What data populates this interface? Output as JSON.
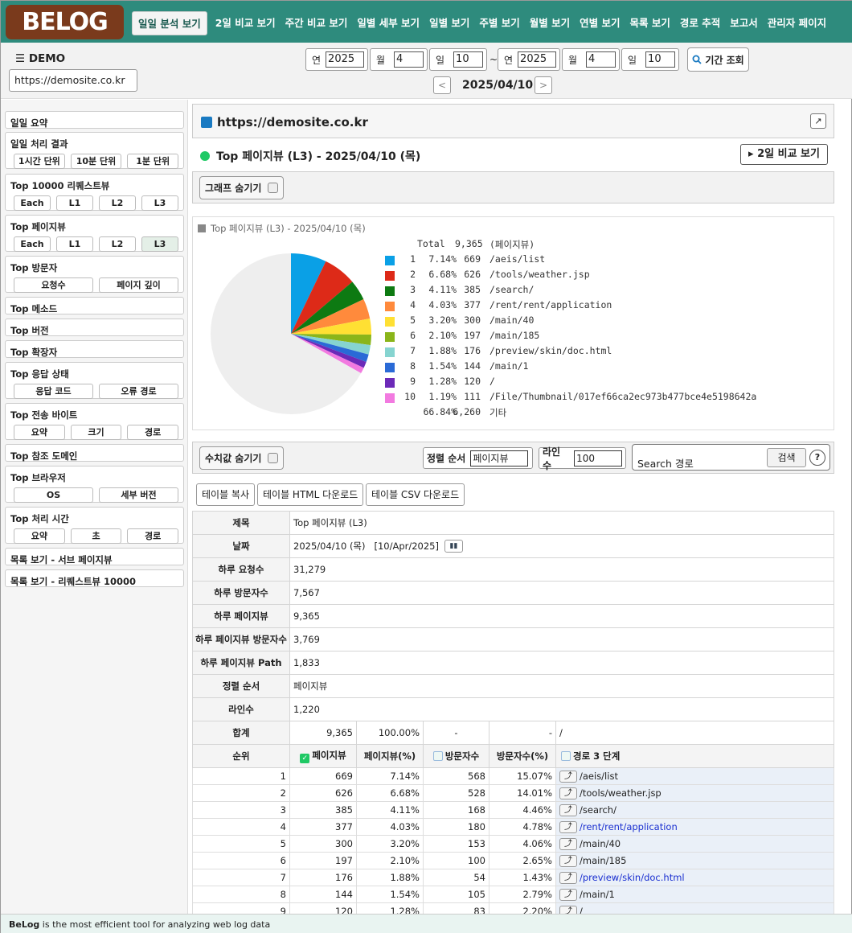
{
  "logo": "BELOG",
  "nav": [
    "일일 분석 보기",
    "2일 비교 보기",
    "주간 비교 보기",
    "일별 세부 보기",
    "일별 보기",
    "주별 보기",
    "월별 보기",
    "연별 보기",
    "목록 보기",
    "경로 추적",
    "보고서",
    "관리자 페이지"
  ],
  "header": {
    "demo": "DEMO",
    "site": "https://demosite.co.kr",
    "from": {
      "y_label": "연",
      "y": "2025",
      "m_label": "월",
      "m": "4",
      "d_label": "일",
      "d": "10"
    },
    "to": {
      "y_label": "연",
      "y": "2025",
      "m_label": "월",
      "m": "4",
      "d_label": "일",
      "d": "10"
    },
    "tilde": "~",
    "query": "기간 조회",
    "date": "2025/04/10"
  },
  "sidebar": [
    {
      "title": "일일 요약",
      "buttons": []
    },
    {
      "title": "일일 처리 결과",
      "buttons": [
        "1시간 단위",
        "10분 단위",
        "1분 단위"
      ]
    },
    {
      "title": "Top 10000 리퀘스트뷰",
      "buttons": [
        "Each",
        "L1",
        "L2",
        "L3"
      ]
    },
    {
      "title": "Top 페이지뷰",
      "buttons": [
        "Each",
        "L1",
        "L2",
        "L3"
      ]
    },
    {
      "title": "Top 방문자",
      "buttons": [
        "요청수",
        "페이지 깊이"
      ]
    },
    {
      "title": "Top 메소드",
      "buttons": []
    },
    {
      "title": "Top 버전",
      "buttons": []
    },
    {
      "title": "Top 확장자",
      "buttons": []
    },
    {
      "title": "Top 응답 상태",
      "buttons": [
        "응답 코드",
        "오류 경로"
      ]
    },
    {
      "title": "Top 전송 바이트",
      "buttons": [
        "요약",
        "크기",
        "경로"
      ]
    },
    {
      "title": "Top 참조 도메인",
      "buttons": []
    },
    {
      "title": "Top 브라우저",
      "buttons": [
        "OS",
        "세부 버전"
      ]
    },
    {
      "title": "Top 처리 시간",
      "buttons": [
        "요약",
        "초",
        "경로"
      ]
    },
    {
      "title": "목록 보기 - 서브 페이지뷰",
      "buttons": []
    },
    {
      "title": "목록 보기 - 리퀘스트뷰 10000",
      "buttons": []
    }
  ],
  "main": {
    "site": "https://demosite.co.kr",
    "section": "Top 페이지뷰 (L3) - 2025/04/10 (목)",
    "compare": "2일 비교 보기",
    "hide_graph": "그래프 숨기기",
    "hide_values": "수치값 숨기기",
    "sort_label": "정렬 순서",
    "sort_value": "페이지뷰",
    "lines_label": "라인수",
    "lines_value": "100",
    "search_placeholder": "Search 경로",
    "search_btn": "검색",
    "help": "?",
    "copy": "테이블 복사",
    "html": "테이블 HTML 다운로드",
    "csv": "테이블 CSV 다운로드"
  },
  "chart_data": {
    "type": "pie",
    "title": "Top 페이지뷰 (L3) - 2025/04/10 (목)",
    "total_label": "Total",
    "total": "9,365",
    "total_unit": "(페이지뷰)",
    "slices": [
      {
        "rank": "1",
        "pct": "7.14%",
        "count": "669",
        "path": "/aeis/list",
        "color": "#0aa0e6",
        "value": 7.14
      },
      {
        "rank": "2",
        "pct": "6.68%",
        "count": "626",
        "path": "/tools/weather.jsp",
        "color": "#dd2a18",
        "value": 6.68
      },
      {
        "rank": "3",
        "pct": "4.11%",
        "count": "385",
        "path": "/search/",
        "color": "#0d7a12",
        "value": 4.11
      },
      {
        "rank": "4",
        "pct": "4.03%",
        "count": "377",
        "path": "/rent/rent/application",
        "color": "#ff8a3c",
        "value": 4.03
      },
      {
        "rank": "5",
        "pct": "3.20%",
        "count": "300",
        "path": "/main/40",
        "color": "#ffe033",
        "value": 3.2
      },
      {
        "rank": "6",
        "pct": "2.10%",
        "count": "197",
        "path": "/main/185",
        "color": "#8ab51a",
        "value": 2.1
      },
      {
        "rank": "7",
        "pct": "1.88%",
        "count": "176",
        "path": "/preview/skin/doc.html",
        "color": "#86d4d0",
        "value": 1.88
      },
      {
        "rank": "8",
        "pct": "1.54%",
        "count": "144",
        "path": "/main/1",
        "color": "#2a6ad6",
        "value": 1.54
      },
      {
        "rank": "9",
        "pct": "1.28%",
        "count": "120",
        "path": "/",
        "color": "#6c2ab8",
        "value": 1.28
      },
      {
        "rank": "10",
        "pct": "1.19%",
        "count": "111",
        "path": "/File/Thumbnail/017ef66ca2ec973b477bce4e5198642a",
        "color": "#f27ae0",
        "value": 1.19
      }
    ],
    "other": {
      "pct": "66.84%",
      "count": "6,260",
      "label": "기타",
      "color": "#eeeeee",
      "value": 66.84
    }
  },
  "info": [
    {
      "k": "제목",
      "v": "Top 페이지뷰 (L3)"
    },
    {
      "k": "날짜",
      "v": "2025/04/10 (목)   [10/Apr/2025]"
    },
    {
      "k": "하루 요청수",
      "v": "31,279"
    },
    {
      "k": "하루 방문자수",
      "v": "7,567"
    },
    {
      "k": "하루 페이지뷰",
      "v": "9,365"
    },
    {
      "k": "하루 페이지뷰 방문자수",
      "v": "3,769"
    },
    {
      "k": "하루 페이지뷰 Path",
      "v": "1,833"
    },
    {
      "k": "정렬 순서",
      "v": "페이지뷰"
    },
    {
      "k": "라인수",
      "v": "1,220"
    }
  ],
  "sum": {
    "k": "합계",
    "pv": "9,365",
    "pvp": "100.00%",
    "vis": "-",
    "visp": "-",
    "path": "/"
  },
  "cols": {
    "rank": "순위",
    "pv": "페이지뷰",
    "pvp": "페이지뷰(%)",
    "vis": "방문자수",
    "visp": "방문자수(%)",
    "path": "경로 3 단계"
  },
  "rows": [
    {
      "r": "1",
      "pv": "669",
      "pvp": "7.14%",
      "v": "568",
      "vp": "15.07%",
      "p": "/aeis/list",
      "link": false
    },
    {
      "r": "2",
      "pv": "626",
      "pvp": "6.68%",
      "v": "528",
      "vp": "14.01%",
      "p": "/tools/weather.jsp",
      "link": false
    },
    {
      "r": "3",
      "pv": "385",
      "pvp": "4.11%",
      "v": "168",
      "vp": "4.46%",
      "p": "/search/",
      "link": false
    },
    {
      "r": "4",
      "pv": "377",
      "pvp": "4.03%",
      "v": "180",
      "vp": "4.78%",
      "p": "/rent/rent/application",
      "link": true
    },
    {
      "r": "5",
      "pv": "300",
      "pvp": "3.20%",
      "v": "153",
      "vp": "4.06%",
      "p": "/main/40",
      "link": false
    },
    {
      "r": "6",
      "pv": "197",
      "pvp": "2.10%",
      "v": "100",
      "vp": "2.65%",
      "p": "/main/185",
      "link": false
    },
    {
      "r": "7",
      "pv": "176",
      "pvp": "1.88%",
      "v": "54",
      "vp": "1.43%",
      "p": "/preview/skin/doc.html",
      "link": true
    },
    {
      "r": "8",
      "pv": "144",
      "pvp": "1.54%",
      "v": "105",
      "vp": "2.79%",
      "p": "/main/1",
      "link": false
    },
    {
      "r": "9",
      "pv": "120",
      "pvp": "1.28%",
      "v": "83",
      "vp": "2.20%",
      "p": "/",
      "link": false
    }
  ],
  "footer": {
    "brand": "BeLog",
    "text": " is the most efficient tool for analyzing web log data"
  }
}
